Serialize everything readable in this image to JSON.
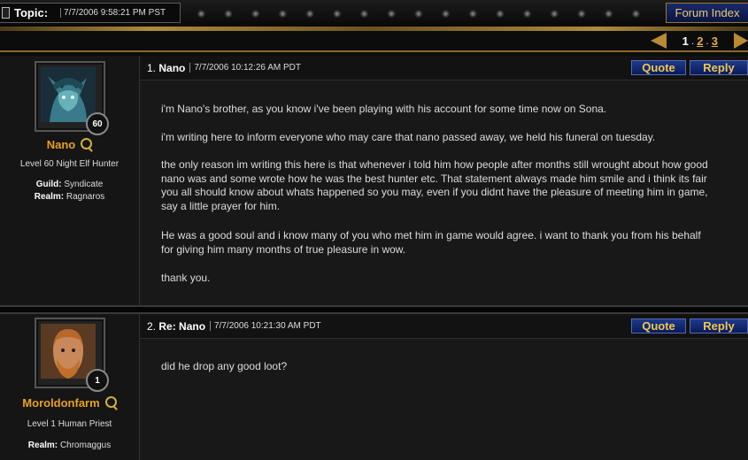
{
  "topbar": {
    "topic_label": "Topic:",
    "topic_date": "7/7/2006 9:58:21 PM PST",
    "forum_index_label": "Forum Index"
  },
  "pagination": {
    "current": "1",
    "pages": [
      "2",
      "3"
    ]
  },
  "posts": [
    {
      "number": "1.",
      "title": "Nano",
      "date": "7/7/2006 10:12:26 AM PDT",
      "quote_label": "Quote",
      "reply_label": "Reply",
      "author": {
        "name": "Nano",
        "level_badge": "60",
        "class_line": "Level 60 Night Elf Hunter",
        "guild_label": "Guild:",
        "guild": "Syndicate",
        "realm_label": "Realm:",
        "realm": "Ragnaros"
      },
      "paragraphs": [
        "i'm Nano's brother, as you know i've been playing with his account for some time now on Sona.",
        "i'm writing here to inform everyone who may care that nano passed away, we held his funeral on tuesday.",
        "the only reason im writing this here is that whenever i told him how people after months still wrought about how good nano was and some wrote how he was the best hunter etc. That statement always made him smile and i think its fair you all should know about whats happened so you may, even if you didnt have the pleasure of meeting him in game, say a little prayer for him.",
        "He was a good soul and i know many of you who met him in game would agree. i want to thank you from his behalf for giving him many months of true pleasure in wow.",
        "thank you."
      ]
    },
    {
      "number": "2.",
      "title": "Re: Nano",
      "date": "7/7/2006 10:21:30 AM PDT",
      "quote_label": "Quote",
      "reply_label": "Reply",
      "author": {
        "name": "Moroldonfarm",
        "level_badge": "1",
        "class_line": "Level 1 Human Priest",
        "realm_label": "Realm:",
        "realm": "Chromaggus"
      },
      "paragraphs": [
        "did he drop any good loot?"
      ]
    }
  ]
}
